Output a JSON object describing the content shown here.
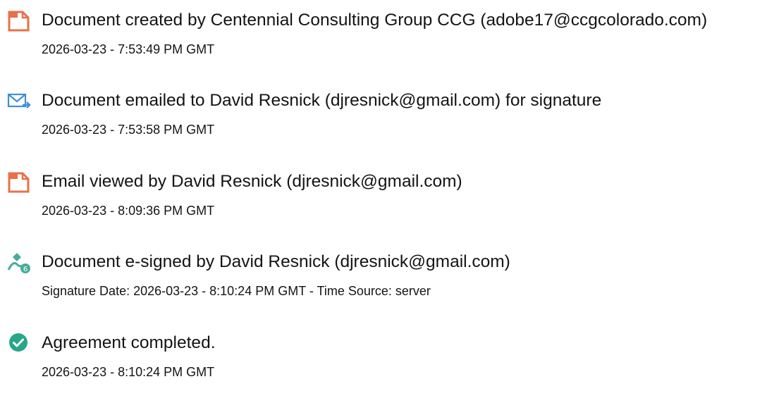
{
  "events": [
    {
      "icon": "document-icon",
      "title": "Document created by Centennial Consulting Group CCG (adobe17@ccgcolorado.com)",
      "meta": "2026-03-23 - 7:53:49 PM GMT"
    },
    {
      "icon": "email-icon",
      "title": "Document emailed to David Resnick (djresnick@gmail.com) for signature",
      "meta": "2026-03-23 - 7:53:58 PM GMT"
    },
    {
      "icon": "document-icon",
      "title": "Email viewed by David Resnick (djresnick@gmail.com)",
      "meta": "2026-03-23 - 8:09:36 PM GMT"
    },
    {
      "icon": "signature-pen-icon",
      "title": "Document e-signed by David Resnick (djresnick@gmail.com)",
      "meta": "Signature Date: 2026-03-23 - 8:10:24 PM GMT - Time Source: server"
    },
    {
      "icon": "checkmark-circle-icon",
      "title": "Agreement completed.",
      "meta": "2026-03-23 - 8:10:24 PM GMT"
    }
  ],
  "colors": {
    "document_icon": "#e8704a",
    "email_icon": "#3d8fd6",
    "signature_icon": "#4aab9a",
    "complete_icon": "#27a68a",
    "text": "#141414"
  }
}
